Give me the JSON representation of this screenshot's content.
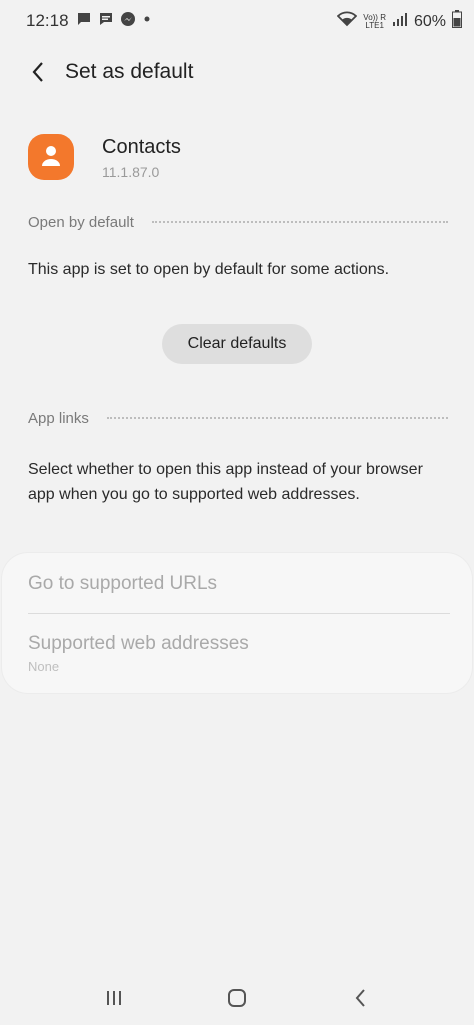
{
  "status_bar": {
    "time": "12:18",
    "notification_icons": [
      "message-icon",
      "chat-icon",
      "messenger-icon",
      "dot-icon"
    ],
    "network_top": "Vo)) R",
    "network_bottom": "LTE1",
    "battery": "60%"
  },
  "app_bar": {
    "title": "Set as default"
  },
  "app": {
    "name": "Contacts",
    "version": "11.1.87.0",
    "icon_color": "#f3782c"
  },
  "open_by_default": {
    "header": "Open by default",
    "description": "This app is set to open by default for some actions.",
    "clear_button": "Clear defaults"
  },
  "app_links": {
    "header": "App links",
    "description": "Select whether to open this app instead of your browser app when you go to supported web addresses.",
    "items": [
      {
        "primary": "Go to supported URLs"
      },
      {
        "primary": "Supported web addresses",
        "secondary": "None"
      }
    ]
  },
  "nav_bar": {
    "buttons": [
      "recents-icon",
      "home-icon",
      "back-icon"
    ]
  }
}
